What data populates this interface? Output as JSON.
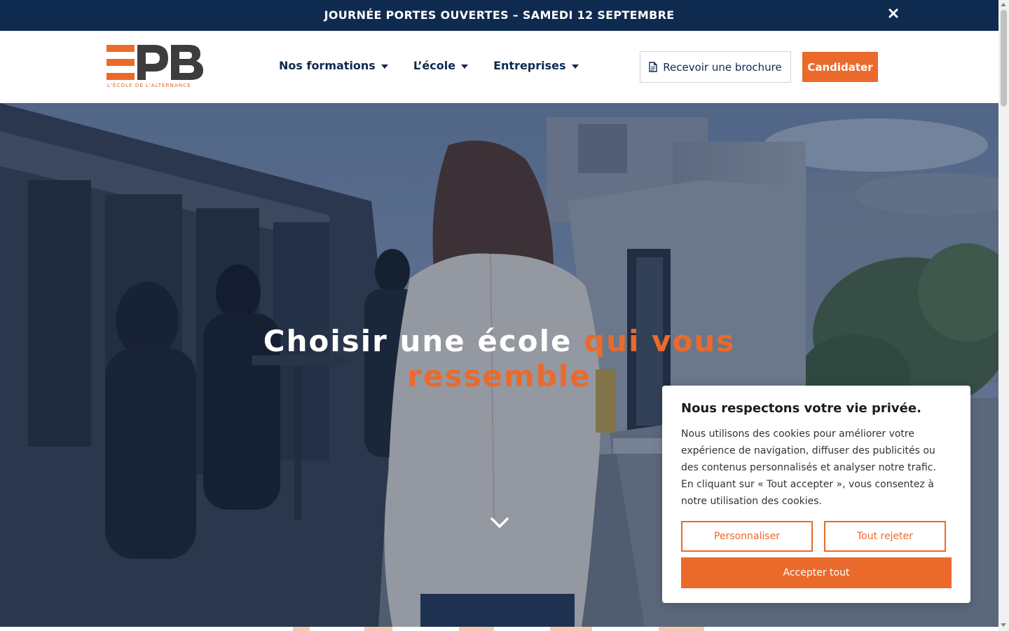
{
  "announcement": {
    "text": "JOURNÉE PORTES OUVERTES – SAMEDI 12 SEPTEMBRE",
    "close_icon": "close-icon"
  },
  "header": {
    "logo": {
      "text": "EPB",
      "tagline": "L'ÉCOLE DE L'ALTERNANCE",
      "colors": {
        "stripes": "#ea6a2c",
        "letters": "#3d3d3d"
      }
    },
    "nav": [
      {
        "label": "Nos formations"
      },
      {
        "label": "L’école"
      },
      {
        "label": "Entreprises"
      }
    ],
    "brochure_label": "Recevoir une brochure",
    "brochure_icon": "document-icon",
    "apply_label": "Candidater"
  },
  "hero": {
    "title_plain": "Choisir une école ",
    "title_accent": "qui vous ressemble",
    "scroll_icon": "chevron-down-icon"
  },
  "cookie": {
    "title": "Nous respectons votre vie privée.",
    "text": "Nous utilisons des cookies pour améliorer votre expérience de navigation, diffuser des publicités ou des contenus personnalisés et analyser notre trafic. En cliquant sur « Tout accepter », vous consentez à notre utilisation des cookies.",
    "customize_label": "Personnaliser",
    "reject_label": "Tout rejeter",
    "accept_label": "Accepter tout"
  },
  "colors": {
    "navy": "#0e2a4f",
    "accent": "#ea6a2c"
  }
}
